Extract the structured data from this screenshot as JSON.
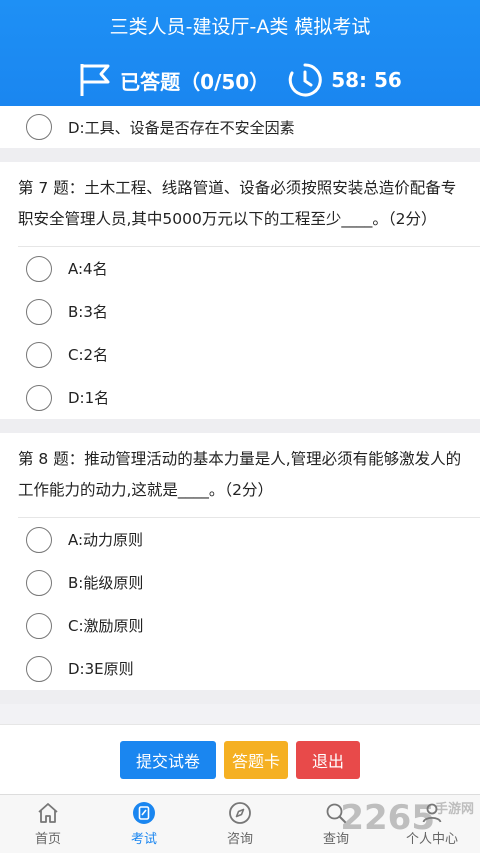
{
  "header": {
    "title": "三类人员-建设厅-A类 模拟考试",
    "answered_label": "已答题（0/50）",
    "timer": "58: 56"
  },
  "questions": [
    {
      "partial": true,
      "options": [
        {
          "label": "D:工具、设备是否存在不安全因素"
        }
      ]
    },
    {
      "text": "第 7 题：土木工程、线路管道、设备必须按照安装总造价配备专职安全管理人员,其中5000万元以下的工程至少____。（2分）",
      "options": [
        {
          "label": "A:4名"
        },
        {
          "label": "B:3名"
        },
        {
          "label": "C:2名"
        },
        {
          "label": "D:1名"
        }
      ]
    },
    {
      "text": "第 8 题：推动管理活动的基本力量是人,管理必须有能够激发人的工作能力的动力,这就是____。（2分）",
      "options": [
        {
          "label": "A:动力原则"
        },
        {
          "label": "B:能级原则"
        },
        {
          "label": "C:激励原则"
        },
        {
          "label": "D:3E原则"
        }
      ]
    }
  ],
  "actions": {
    "submit": "提交试卷",
    "answer_card": "答题卡",
    "exit": "退出"
  },
  "tabs": [
    {
      "label": "首页",
      "icon": "home-icon"
    },
    {
      "label": "考试",
      "icon": "exam-icon",
      "active": true
    },
    {
      "label": "咨询",
      "icon": "compass-icon"
    },
    {
      "label": "查询",
      "icon": "search-icon"
    },
    {
      "label": "个人中心",
      "icon": "user-icon"
    }
  ],
  "watermark": {
    "text": "2265",
    "sub": "手游网"
  },
  "colors": {
    "primary": "#1a86f0",
    "warning": "#f5b022",
    "danger": "#e84a4a"
  }
}
